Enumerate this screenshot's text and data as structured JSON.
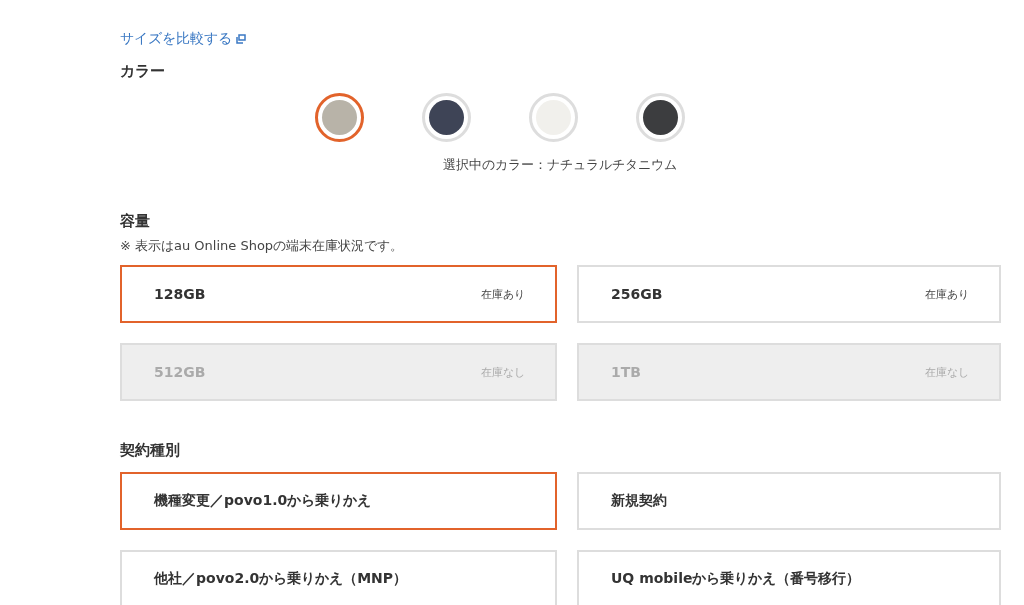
{
  "size_link": {
    "label": "サイズを比較する"
  },
  "color_section": {
    "heading": "カラー",
    "swatches": [
      {
        "color": "#b8b3a8",
        "selected": true
      },
      {
        "color": "#3e4456",
        "selected": false
      },
      {
        "color": "#f1f0ec",
        "selected": false
      },
      {
        "color": "#3c3d3f",
        "selected": false
      }
    ],
    "selected_label": "選択中のカラー：ナチュラルチタニウム"
  },
  "capacity_section": {
    "heading": "容量",
    "note": "※  表示はau Online Shopの端末在庫状況です。",
    "options": [
      {
        "label": "128GB",
        "stock": "在庫あり",
        "selected": true,
        "disabled": false
      },
      {
        "label": "256GB",
        "stock": "在庫あり",
        "selected": false,
        "disabled": false
      },
      {
        "label": "512GB",
        "stock": "在庫なし",
        "selected": false,
        "disabled": true
      },
      {
        "label": "1TB",
        "stock": "在庫なし",
        "selected": false,
        "disabled": true
      }
    ]
  },
  "contract_section": {
    "heading": "契約種別",
    "options": [
      {
        "label": "機種変更／povo1.0から乗りかえ",
        "selected": true
      },
      {
        "label": "新規契約",
        "selected": false
      },
      {
        "label": "他社／povo2.0から乗りかえ（MNP）",
        "selected": false
      },
      {
        "label": "UQ mobileから乗りかえ（番号移行）",
        "selected": false
      }
    ]
  }
}
